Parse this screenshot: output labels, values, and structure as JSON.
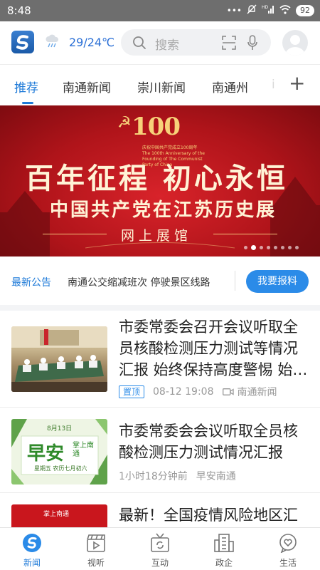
{
  "status": {
    "time": "8:48",
    "battery": "92",
    "network": "HD"
  },
  "header": {
    "temperature": "29/24℃",
    "search_placeholder": "搜索",
    "weather_icon": "cloud-rain-icon"
  },
  "tabs": [
    {
      "label": "推荐",
      "active": true
    },
    {
      "label": "南通新闻"
    },
    {
      "label": "崇川新闻"
    },
    {
      "label": "南通州"
    },
    {
      "label": "i"
    }
  ],
  "banner": {
    "number": "100",
    "subtitle": "庆祝中国共产党成立100周年",
    "subtitle_en": "The 100th Anniversary of the Founding of The Communist Party of China",
    "title": "百年征程 初心永恒",
    "subtitle2": "中国共产党在江苏历史展",
    "caption": "网上展馆",
    "slide_count": 8,
    "active_slide": 1
  },
  "notice": {
    "label": "最新公告",
    "text": "南通公交缩减班次 停驶景区线路",
    "report_button": "我要报料"
  },
  "news": [
    {
      "title": "市委常委会召开会议听取全员核酸检测压力测试等情况汇报 始终保持高度警惕 始…",
      "pin": "置顶",
      "time": "08-12 19:08",
      "source": "南通新闻"
    },
    {
      "title": "市委常委会会议听取全员核酸检测压力测试情况汇报",
      "time": "1小时18分钟前",
      "source": "早安南通",
      "thumb_date": "8月13日",
      "thumb_big": "早安",
      "thumb_brand": "掌上南通",
      "thumb_week": "星期五  农历七月初六"
    },
    {
      "title": "最新！全国疫情风险地区汇",
      "thumb_brand": "掌上南通"
    }
  ],
  "bottom_nav": [
    {
      "label": "新闻",
      "icon": "news-logo-icon",
      "active": true
    },
    {
      "label": "视听",
      "icon": "clapperboard-icon"
    },
    {
      "label": "互动",
      "icon": "tv-refresh-icon"
    },
    {
      "label": "政企",
      "icon": "building-icon"
    },
    {
      "label": "生活",
      "icon": "heart-chat-icon"
    }
  ],
  "colors": {
    "accent": "#1e7ad8",
    "banner_red": "#c41a20",
    "report_button": "#2b8be8"
  }
}
